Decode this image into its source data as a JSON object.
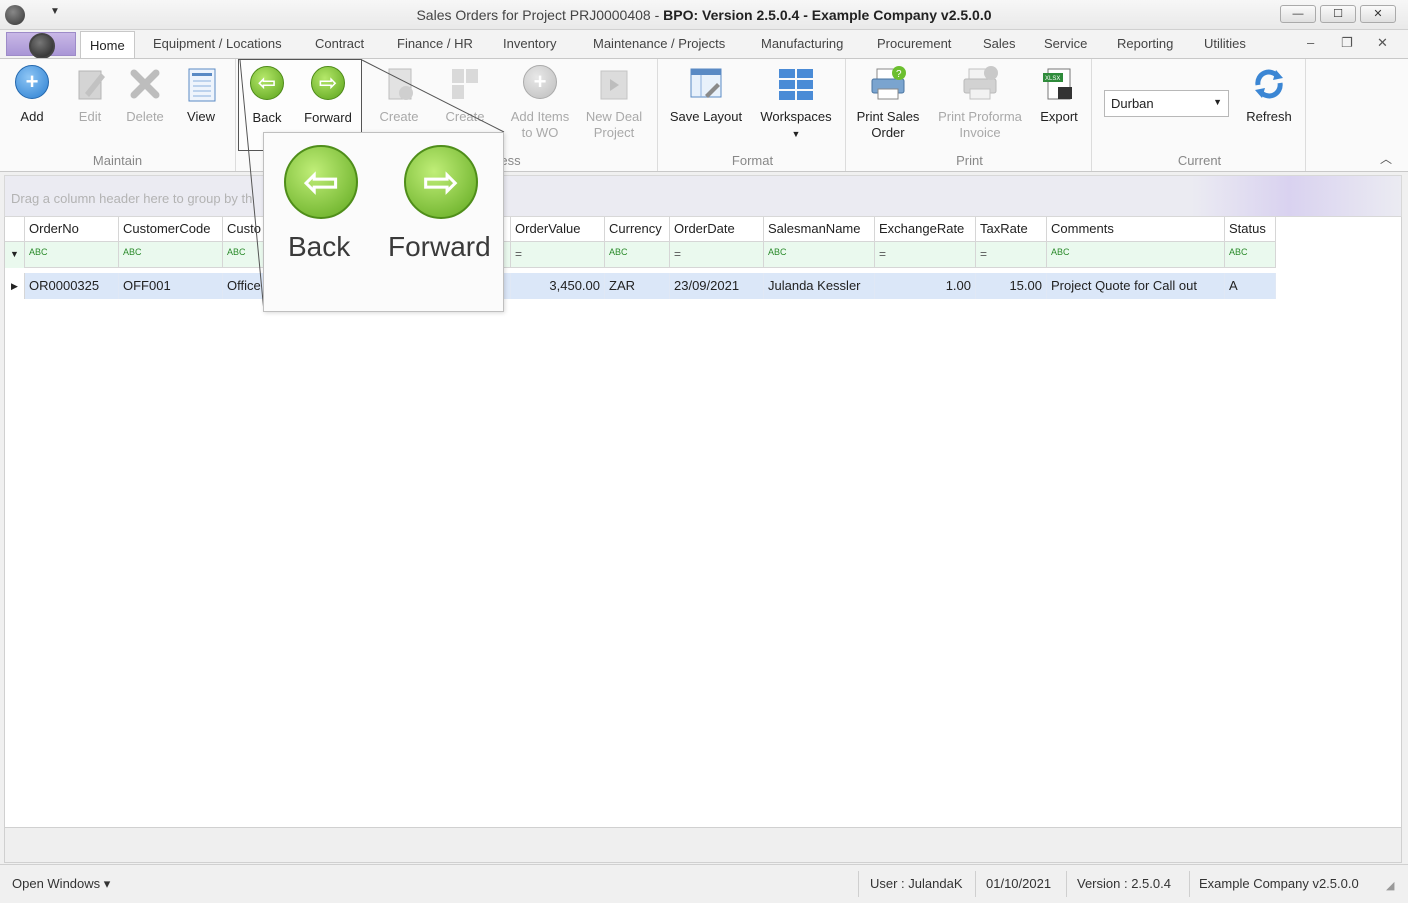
{
  "window": {
    "title_plain": "Sales Orders for Project PRJ0000408 - ",
    "title_bold": "BPO: Version 2.5.0.4 - Example Company v2.5.0.0",
    "min": "—",
    "max": "☐",
    "close": "✕"
  },
  "tabs": [
    "Home",
    "Equipment / Locations",
    "Contract",
    "Finance / HR",
    "Inventory",
    "Maintenance / Projects",
    "Manufacturing",
    "Procurement",
    "Sales",
    "Service",
    "Reporting",
    "Utilities"
  ],
  "ribbon": {
    "maintain": {
      "label": "Maintain",
      "add": "Add",
      "edit": "Edit",
      "delete": "Delete",
      "view": "View"
    },
    "nav": {
      "back": "Back",
      "forward": "Forward"
    },
    "process": {
      "label": "ess",
      "create1": "Create",
      "create2": "Create",
      "add_items_1": "Add Items",
      "add_items_2": "to WO",
      "new_deal_1": "New Deal",
      "new_deal_2": "Project"
    },
    "format": {
      "label": "Format",
      "save_layout": "Save Layout",
      "workspaces": "Workspaces"
    },
    "print": {
      "label": "Print",
      "print_sales_1": "Print Sales",
      "print_sales_2": "Order",
      "print_proforma_1": "Print Proforma",
      "print_proforma_2": "Invoice",
      "export": "Export"
    },
    "current": {
      "label": "Current",
      "site": "Durban",
      "refresh": "Refresh"
    }
  },
  "grid": {
    "group_panel_hint": "Drag a column header here to group by th",
    "columns": [
      "OrderNo",
      "CustomerCode",
      "Custo",
      "OrderValue",
      "Currency",
      "OrderDate",
      "SalesmanName",
      "ExchangeRate",
      "TaxRate",
      "Comments",
      "Status"
    ],
    "filters": [
      "ABC",
      "ABC",
      "ABC",
      "=",
      "ABC",
      "=",
      "ABC",
      "=",
      "=",
      "ABC",
      "ABC"
    ],
    "rows": [
      [
        "OR0000325",
        "OFF001",
        "Office",
        "3,450.00",
        "ZAR",
        "23/09/2021",
        "Julanda Kessler",
        "1.00",
        "15.00",
        "Project Quote for Call out",
        "A"
      ]
    ]
  },
  "callout": {
    "back": "Back",
    "forward": "Forward"
  },
  "status": {
    "open_windows": "Open Windows ▾",
    "user": "User : JulandaK",
    "date": "01/10/2021",
    "version": "Version : 2.5.0.4",
    "company": "Example Company v2.5.0.0"
  }
}
